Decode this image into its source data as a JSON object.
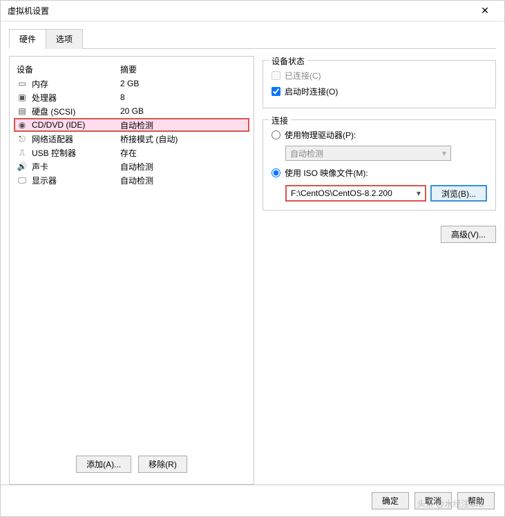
{
  "window": {
    "title": "虚拟机设置"
  },
  "tabs": {
    "hardware": "硬件",
    "options": "选项"
  },
  "headers": {
    "device": "设备",
    "summary": "摘要"
  },
  "hw": {
    "memory": {
      "label": "内存",
      "summary": "2 GB"
    },
    "cpu": {
      "label": "处理器",
      "summary": "8"
    },
    "disk": {
      "label": "硬盘 (SCSI)",
      "summary": "20 GB"
    },
    "cd": {
      "label": "CD/DVD (IDE)",
      "summary": "自动检测"
    },
    "net": {
      "label": "网络适配器",
      "summary": "桥接模式 (自动)"
    },
    "usb": {
      "label": "USB 控制器",
      "summary": "存在"
    },
    "sound": {
      "label": "声卡",
      "summary": "自动检测"
    },
    "display": {
      "label": "显示器",
      "summary": "自动检测"
    }
  },
  "status": {
    "group": "设备状态",
    "connected": "已连接(C)",
    "connectAtPower": "启动时连接(O)"
  },
  "connection": {
    "group": "连接",
    "physical": "使用物理驱动器(P):",
    "autoDetect": "自动检测",
    "iso": "使用 ISO 映像文件(M):",
    "isoPath": "F:\\CentOS\\CentOS-8.2.200",
    "browse": "浏览(B)..."
  },
  "buttons": {
    "add": "添加(A)...",
    "remove": "移除(R)",
    "advanced": "高级(V)...",
    "ok": "确定",
    "cancel": "取消",
    "help": "帮助"
  },
  "watermark": "头条 @水经注GIS"
}
